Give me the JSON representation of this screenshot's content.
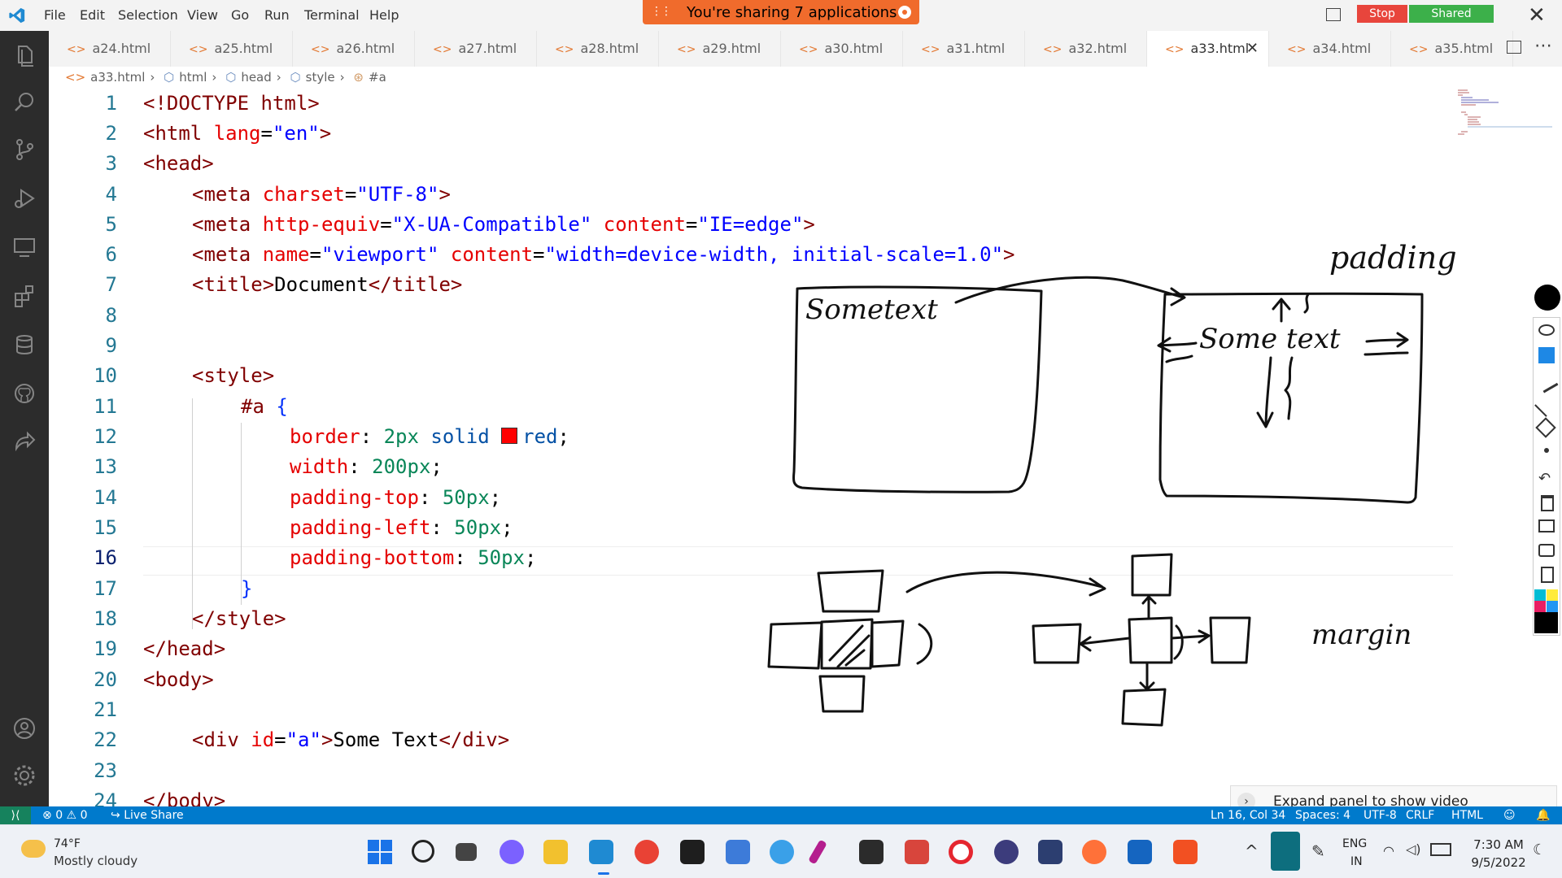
{
  "menu": [
    "File",
    "Edit",
    "Selection",
    "View",
    "Go",
    "Run",
    "Terminal",
    "Help"
  ],
  "share_banner": {
    "text": "You're sharing 7 applications",
    "stop": "Stop",
    "shared": "Shared"
  },
  "tabs": [
    {
      "label": "a24.html"
    },
    {
      "label": "a25.html"
    },
    {
      "label": "a26.html"
    },
    {
      "label": "a27.html"
    },
    {
      "label": "a28.html"
    },
    {
      "label": "a29.html"
    },
    {
      "label": "a30.html"
    },
    {
      "label": "a31.html"
    },
    {
      "label": "a32.html"
    },
    {
      "label": "a33.html",
      "active": true
    },
    {
      "label": "a34.html"
    },
    {
      "label": "a35.html"
    }
  ],
  "breadcrumb": [
    "a33.html",
    "html",
    "head",
    "style",
    "#a"
  ],
  "line_numbers": [
    "1",
    "2",
    "3",
    "4",
    "5",
    "6",
    "7",
    "8",
    "9",
    "10",
    "11",
    "12",
    "13",
    "14",
    "15",
    "16",
    "17",
    "18",
    "19",
    "20",
    "21",
    "22",
    "23",
    "24"
  ],
  "code": {
    "l1": {
      "a": "<!DOCTYPE",
      "b": " html",
      ">": ">"
    },
    "l2": {
      "tag": "<html",
      "attr": " lang",
      "eq": "=",
      "val": "\"en\"",
      "close": ">"
    },
    "l3": "<head>",
    "l4": {
      "tag": "<meta",
      "attr": " charset",
      "eq": "=",
      "val": "\"UTF-8\"",
      "close": ">"
    },
    "l5": {
      "tag": "<meta",
      "attr1": " http-equiv",
      "eq1": "=",
      "val1": "\"X-UA-Compatible\"",
      "attr2": " content",
      "eq2": "=",
      "val2": "\"IE=edge\"",
      "close": ">"
    },
    "l6": {
      "tag": "<meta",
      "attr1": " name",
      "eq1": "=",
      "val1": "\"viewport\"",
      "attr2": " content",
      "eq2": "=",
      "val2": "\"width=device-width, initial-scale=1.0\"",
      "close": ">"
    },
    "l7": {
      "open": "<title>",
      "text": "Document",
      "close": "</title>"
    },
    "l10": "<style>",
    "l11": {
      "sel": "#a",
      "brace": " {"
    },
    "l12": {
      "prop": "border",
      "colon": ": ",
      "v1": "2px",
      "v2": " solid ",
      "v3": "red",
      "semi": ";"
    },
    "l13": {
      "prop": "width",
      "colon": ": ",
      "v": "200px",
      "semi": ";"
    },
    "l14": {
      "prop": "padding-top",
      "colon": ": ",
      "v": "50px",
      "semi": ";"
    },
    "l15": {
      "prop": "padding-left",
      "colon": ": ",
      "v": "50px",
      "semi": ";"
    },
    "l16": {
      "prop": "padding-bottom",
      "colon": ": ",
      "v": "50px",
      "semi": ";"
    },
    "l17": "}",
    "l18": "</style>",
    "l19": "</head>",
    "l20": "<body>",
    "l22": {
      "open": "<div",
      "attr": " id",
      "eq": "=",
      "val": "\"a\"",
      "gt": ">",
      "text": "Some Text",
      "close": "</div>"
    },
    "l24": "</body>"
  },
  "annotations": {
    "padding": "padding",
    "sometext_left": "Sometext",
    "sometext_right": "Some text",
    "margin": "margin"
  },
  "video_panel": "Expand panel to show video",
  "status": {
    "problems": "0",
    "warnings": "0",
    "live_share": "Live Share",
    "position": "Ln 16, Col 34",
    "spaces": "Spaces: 4",
    "encoding": "UTF-8",
    "eol": "CRLF",
    "language": "HTML"
  },
  "weather": {
    "temp": "74°F",
    "desc": "Mostly cloudy"
  },
  "tray": {
    "lang1": "ENG",
    "lang2": "IN",
    "time": "7:30 AM",
    "date": "9/5/2022"
  },
  "colors": {
    "accent": "#007acc",
    "banner": "#f06b2c",
    "stop": "#e8453c",
    "shared": "#3cb04a"
  }
}
